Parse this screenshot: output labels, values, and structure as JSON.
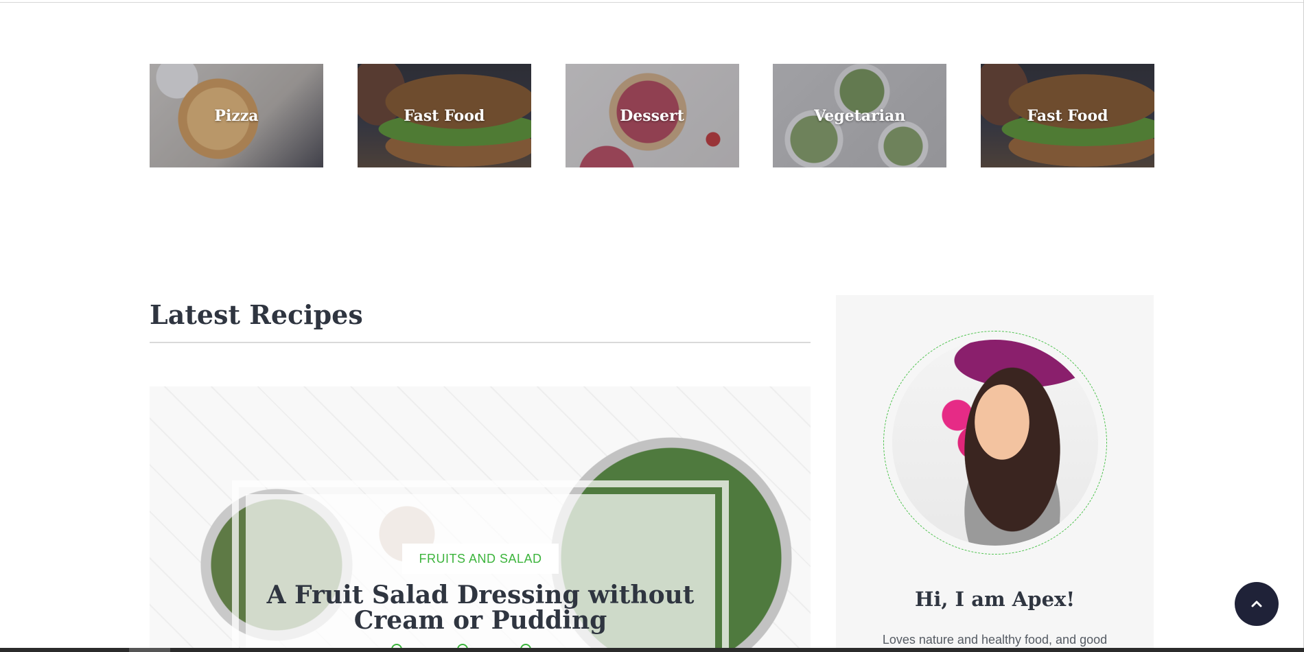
{
  "categories": [
    {
      "label": "Pizza",
      "image": "pizza-photo"
    },
    {
      "label": "Fast Food",
      "image": "burger-photo"
    },
    {
      "label": "Dessert",
      "image": "pie-photo"
    },
    {
      "label": "Vegetarian",
      "image": "salad-bowls-photo"
    },
    {
      "label": "Fast Food",
      "image": "burger-photo"
    }
  ],
  "latest": {
    "title": "Latest Recipes",
    "featured": {
      "category": "FRUITS AND SALAD",
      "title": "A Fruit Salad Dressing without Cream or Pudding"
    }
  },
  "sidebar": {
    "about_title": "Hi, I am Apex!",
    "about_text": "Loves nature and healthy food, and good"
  },
  "icons": {
    "back_to_top": "chevron-up-icon"
  },
  "colors": {
    "accent": "#3cb43c",
    "dark": "#1f2238",
    "heading": "#2f3540"
  }
}
